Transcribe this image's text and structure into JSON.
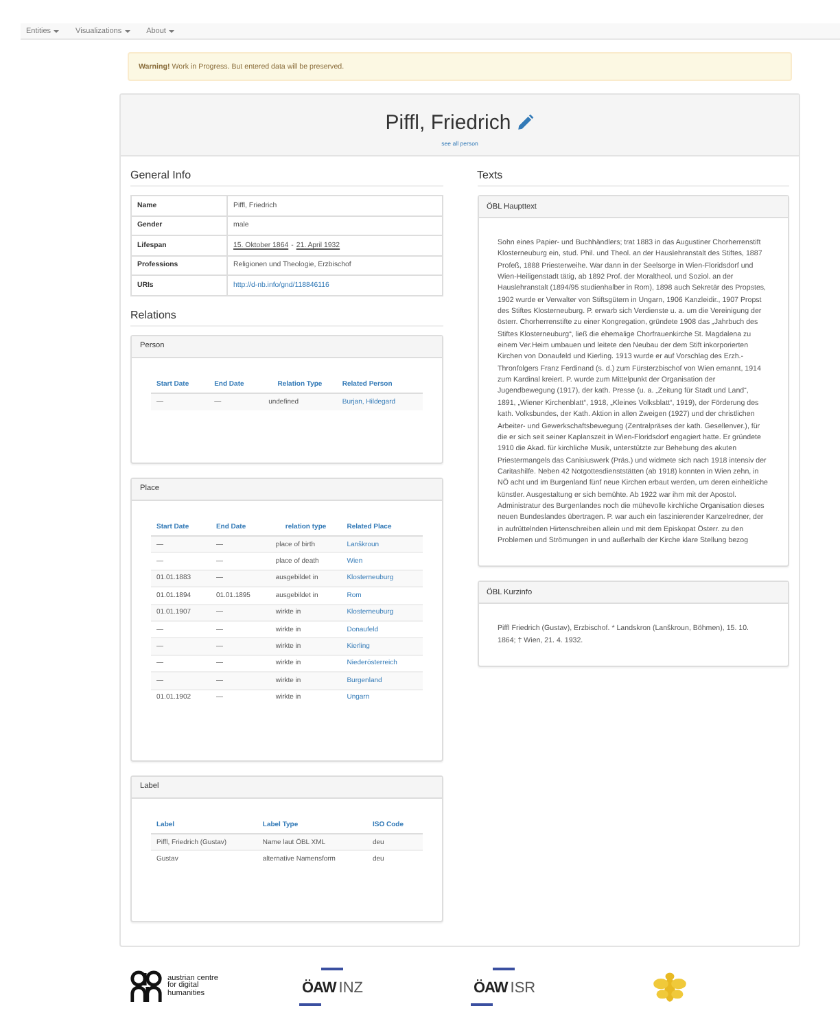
{
  "nav": [
    {
      "label": "Entities"
    },
    {
      "label": "Visualizations"
    },
    {
      "label": "About"
    }
  ],
  "warning": "**Warning!** Work in Progress. But entered data will be preserved.",
  "title": "Piffl, Friedrich",
  "see_all": "see all person",
  "general_info": {
    "heading": "General Info",
    "rows": [
      {
        "label": "Name",
        "kind": "text",
        "value": "Piffl, Friedrich"
      },
      {
        "label": "Gender",
        "kind": "text",
        "value": "male"
      },
      {
        "label": "Lifespan",
        "kind": "dates",
        "start": "15. Oktober 1864",
        "separator": "-",
        "end": "21. April 1932"
      },
      {
        "label": "Professions",
        "kind": "text",
        "value": "Religionen und Theologie, Erzbischof"
      },
      {
        "label": "URIs",
        "kind": "link",
        "value": "http://d-nb.info/gnd/118846116"
      }
    ]
  },
  "relations": {
    "heading": "Relations",
    "panels": [
      {
        "title": "Person",
        "kind": "relation",
        "columns": [
          "Start Date",
          "End Date",
          "Relation Type",
          "Related Person"
        ],
        "rows": [
          [
            "—",
            "—",
            "undefined",
            "Burjan, Hildegard"
          ]
        ]
      },
      {
        "title": "Place",
        "kind": "relation",
        "columns": [
          "Start Date",
          "End Date",
          "relation type",
          "Related Place"
        ],
        "rows": [
          [
            "—",
            "—",
            "place of birth",
            "Lanškroun"
          ],
          [
            "—",
            "—",
            "place of death",
            "Wien"
          ],
          [
            "01.01.1883",
            "—",
            "ausgebildet in",
            "Klosterneuburg"
          ],
          [
            "01.01.1894",
            "01.01.1895",
            "ausgebildet in",
            "Rom"
          ],
          [
            "01.01.1907",
            "—",
            "wirkte in",
            "Klosterneuburg"
          ],
          [
            "—",
            "—",
            "wirkte in",
            "Donaufeld"
          ],
          [
            "—",
            "—",
            "wirkte in",
            "Kierling"
          ],
          [
            "—",
            "—",
            "wirkte in",
            "Niederösterreich"
          ],
          [
            "—",
            "—",
            "wirkte in",
            "Burgenland"
          ],
          [
            "01.01.1902",
            "—",
            "wirkte in",
            "Ungarn"
          ]
        ]
      },
      {
        "title": "Label",
        "kind": "label",
        "columns": [
          "Label",
          "Label Type",
          "ISO Code"
        ],
        "rows": [
          [
            "Piffl, Friedrich (Gustav)",
            "Name laut ÖBL XML",
            "deu"
          ],
          [
            "Gustav",
            "alternative Namensform",
            "deu"
          ]
        ]
      }
    ]
  },
  "texts": {
    "heading": "Texts",
    "panels": [
      {
        "title": "ÖBL Haupttext",
        "text": "Sohn eines Papier- und Buchhändlers; trat 1883 in das Augustiner Chorherrenstift Klosterneuburg ein, stud. Phil. und Theol. an der Hauslehranstalt des Stiftes, 1887 Profeß, 1888 Priesterweihe. War dann in der Seelsorge in Wien-Floridsdorf und Wien-Heiligenstadt tätig, ab 1892 Prof. der Moraltheol. und Soziol. an der Hauslehranstalt (1894/95 studienhalber in Rom), 1898 auch Sekretär des Propstes, 1902 wurde er Verwalter von Stiftsgütern in Ungarn, 1906 Kanzleidir., 1907 Propst des Stiftes Klosterneuburg. P. erwarb sich Verdienste u. a. um die Vereinigung der österr. Chorherrenstifte zu einer Kongregation, gründete 1908 das „Jahrbuch des Stiftes Klosterneuburg“, ließ die ehemalige Chorfrauenkirche St. Magdalena zu einem Ver.Heim umbauen und leitete den Neubau der dem Stift inkorporierten Kirchen von Donaufeld und Kierling. 1913 wurde er auf Vorschlag des Erzh.-Thronfolgers Franz Ferdinand (s. d.) zum Fürsterzbischof von Wien ernannt, 1914 zum Kardinal kreiert. P. wurde zum Mittelpunkt der Organisation der Jugendbewegung (1917), der kath. Presse (u. a. „Zeitung für Stadt und Land“, 1891, „Wiener Kirchenblatt“, 1918, „Kleines Volksblatt“, 1919), der Förderung des kath. Volksbundes, der Kath. Aktion in allen Zweigen (1927) und der christlichen Arbeiter- und Gewerkschaftsbewegung (Zentralpräses der kath. Gesellenver.), für die er sich seit seiner Kaplanszeit in Wien-Floridsdorf engagiert hatte. Er gründete 1910 die Akad. für kirchliche Musik, unterstützte zur Behebung des akuten Priestermangels das Canisiuswerk (Präs.) und widmete sich nach 1918 intensiv der Caritashilfe. Neben 42 Notgottesdienststätten (ab 1918) konnten in Wien zehn, in NÖ acht und im Burgenland fünf neue Kirchen erbaut werden, um deren einheitliche künstler. Ausgestaltung er sich bemühte. Ab 1922 war ihm mit der Apostol. Administratur des Burgenlandes noch die mühevolle kirchliche Organisation dieses neuen Bundeslandes übertragen. P. war auch ein faszinierender Kanzelredner, der in aufrüttelnden Hirtenschreiben allein und mit dem Episkopat Österr. zu den Problemen und Strömungen in und außerhalb der Kirche klare Stellung bezog"
      },
      {
        "title": "ÖBL Kurzinfo",
        "text": "Piffl Friedrich (Gustav), Erzbischof. * Landskron (Lanškroun, Böhmen), 15. 10. 1864; † Wien, 21. 4. 1932."
      }
    ]
  },
  "footer": [
    {
      "kind": "acdh",
      "text": "austrian centre for digital humanities"
    },
    {
      "kind": "oaw",
      "brand": "ÖAW",
      "unit": "INZ"
    },
    {
      "kind": "oaw",
      "brand": "ÖAW",
      "unit": "ISR"
    },
    {
      "kind": "bee"
    }
  ]
}
